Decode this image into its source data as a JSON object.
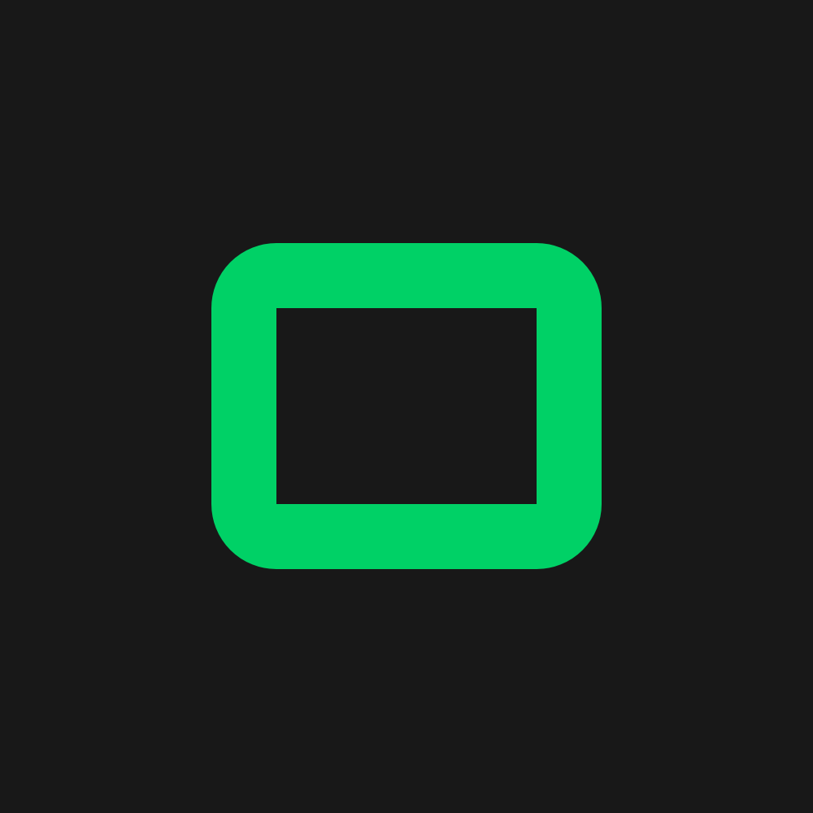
{
  "screen": {
    "background_color": "#181818"
  },
  "icon": {
    "name": "rounded-rectangle-frame-icon",
    "color": "#00d166",
    "inner_color": "#181818"
  }
}
